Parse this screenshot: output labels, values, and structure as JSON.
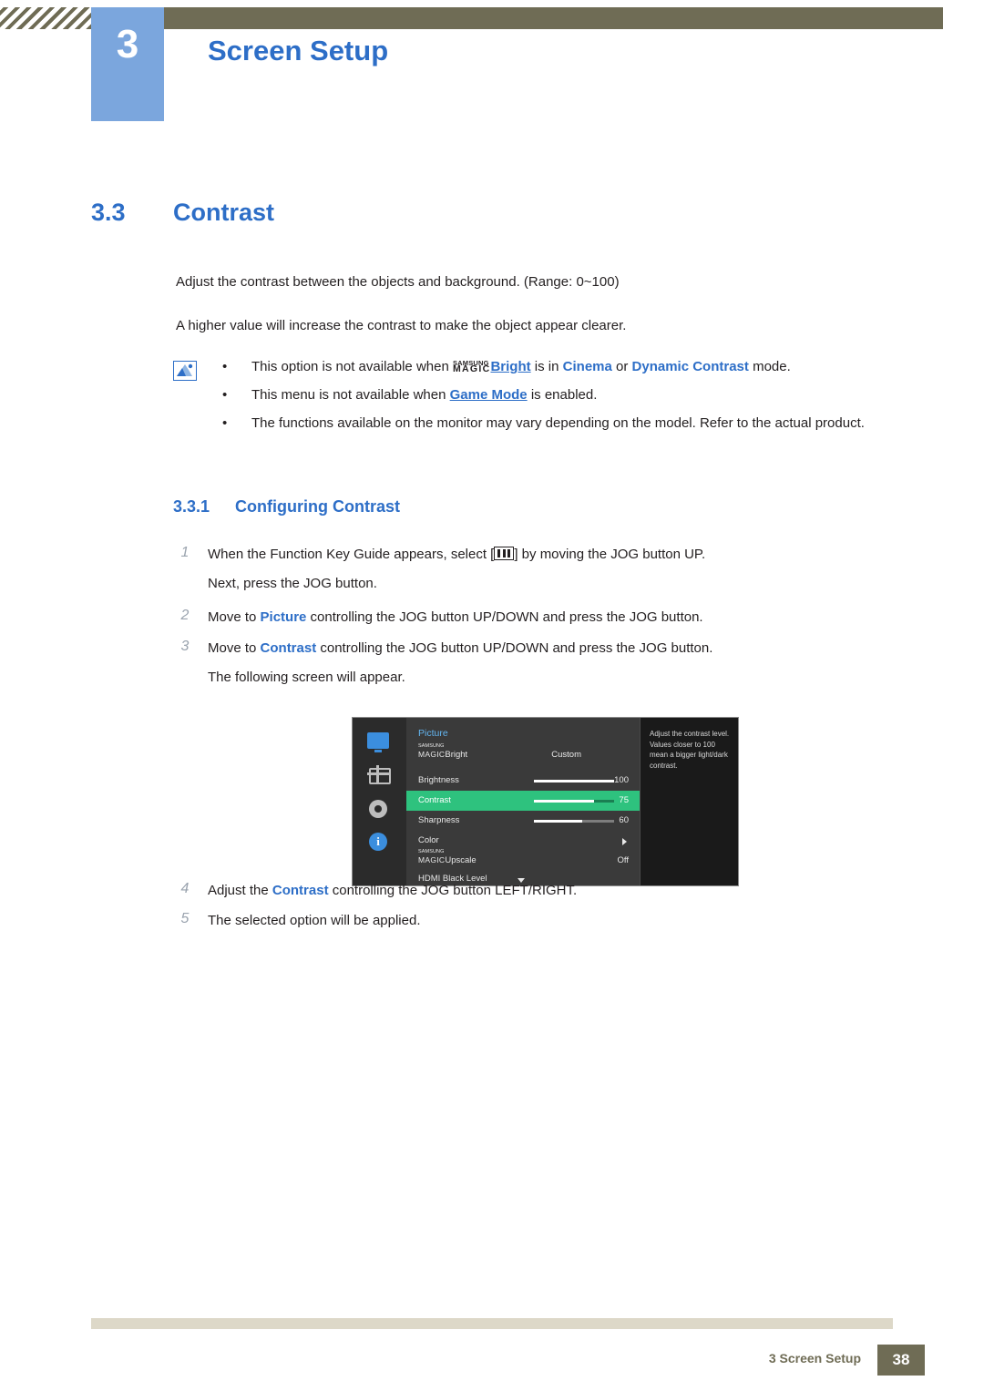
{
  "header": {
    "chapter_number": "3",
    "chapter_title": "Screen Setup"
  },
  "section": {
    "number": "3.3",
    "title": "Contrast"
  },
  "paragraphs": {
    "p1": "Adjust the contrast between the objects and background. (Range: 0~100)",
    "p2": "A higher value will increase the contrast to make the object appear clearer."
  },
  "notes": {
    "item1_pre": "This option is not available when ",
    "item1_magic_top": "SAMSUNG",
    "item1_magic_bottom": "MAGIC",
    "item1_bright": "Bright",
    "item1_mid": " is in ",
    "item1_cinema": "Cinema",
    "item1_or": " or ",
    "item1_dyn": "Dynamic Contrast",
    "item1_post": " mode.",
    "item2_pre": "This menu is not available when ",
    "item2_link": "Game Mode",
    "item2_post": " is enabled.",
    "item3": "The functions available on the monitor may vary depending on the model. Refer to the actual product."
  },
  "subsection": {
    "number": "3.3.1",
    "title": "Configuring Contrast"
  },
  "steps": {
    "n1": "1",
    "s1_pre": "When the Function Key Guide appears, select [",
    "s1_post": "] by moving the JOG button UP.",
    "s1_line2": "Next, press the JOG button.",
    "n2": "2",
    "s2_pre": "Move to ",
    "s2_bold": "Picture",
    "s2_post": " controlling the JOG button UP/DOWN and press the JOG button.",
    "n3": "3",
    "s3_pre": "Move to ",
    "s3_bold": "Contrast",
    "s3_post": " controlling the JOG button UP/DOWN and press the JOG button.",
    "s3_line2": "The following screen will appear.",
    "n4": "4",
    "s4_pre": "Adjust the ",
    "s4_bold": "Contrast",
    "s4_post": " controlling the JOG button LEFT/RIGHT.",
    "n5": "5",
    "s5": "The selected option will be applied."
  },
  "osd": {
    "menu_title": "Picture",
    "rows": [
      {
        "label_magic_top": "SAMSUNG",
        "label_magic_bottom": "MAGIC",
        "label": "Bright",
        "value": "Custom"
      },
      {
        "label": "Brightness",
        "value": "100",
        "bar": 100
      },
      {
        "label": "Contrast",
        "value": "75",
        "bar": 75
      },
      {
        "label": "Sharpness",
        "value": "60",
        "bar": 60
      },
      {
        "label": "Color",
        "value": ""
      },
      {
        "label_magic_top": "SAMSUNG",
        "label_magic_bottom": "MAGIC",
        "label": "Upscale",
        "value": "Off"
      },
      {
        "label": "HDMI Black Level",
        "value": ""
      }
    ],
    "help_text": "Adjust the contrast level. Values closer to 100 mean a bigger light/dark contrast.",
    "icons": [
      "display-icon",
      "picture-icon",
      "system-gear-icon",
      "information-icon"
    ]
  },
  "footer": {
    "text": "3 Screen Setup",
    "page": "38"
  },
  "colors": {
    "accent_blue": "#2d6ec7",
    "badge_blue": "#7ba6dd",
    "olive": "#6f6c55",
    "highlight_green": "#2ec27e"
  }
}
